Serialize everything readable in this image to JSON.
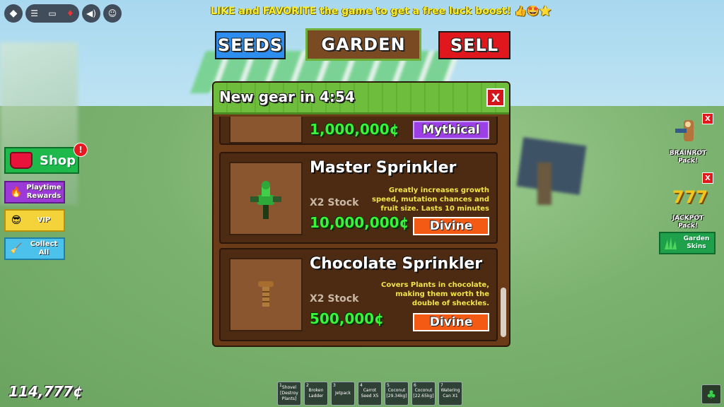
{
  "banner": {
    "text": "LIKE and FAVORITE the game to get a free luck boost! 👍🤩⭐"
  },
  "tabs": [
    {
      "label": "SEEDS"
    },
    {
      "label": "GARDEN"
    },
    {
      "label": "SELL"
    }
  ],
  "panel": {
    "title": "New gear in 4:54",
    "close_label": "X",
    "items": [
      {
        "name": "",
        "stock": "",
        "price": "1,000,000¢",
        "description": "",
        "rarity": "Mythical"
      },
      {
        "name": "Master Sprinkler",
        "stock": "X2 Stock",
        "price": "10,000,000¢",
        "description": "Greatly increases growth speed, mutation chances and fruit size. Lasts 10 minutes",
        "rarity": "Divine"
      },
      {
        "name": "Chocolate Sprinkler",
        "stock": "X2 Stock",
        "price": "500,000¢",
        "description": "Covers Plants in chocolate, making them worth the double of sheckles.",
        "rarity": "Divine"
      }
    ]
  },
  "left_menu": {
    "shop": {
      "label": "Shop",
      "badge": "!"
    },
    "playtime": {
      "label": "Playtime Rewards"
    },
    "vip": {
      "label": "VIP"
    },
    "collect": {
      "label": "Collect All"
    }
  },
  "right_menu": {
    "brainrot": {
      "label": "BRAINROT Pack!",
      "close": "X"
    },
    "jackpot": {
      "label": "JACKPOT Pack!",
      "close": "X",
      "digits": "777"
    },
    "skins": {
      "label": "Garden Skins"
    }
  },
  "money": "114,777¢",
  "hotbar": [
    {
      "num": "1",
      "label": "Shovel [Destroy Plants]"
    },
    {
      "num": "2",
      "label": "Broken Ladder"
    },
    {
      "num": "3",
      "label": "Jetpack"
    },
    {
      "num": "4",
      "label": "Carrot Seed X5"
    },
    {
      "num": "5",
      "label": "Coconut [29.34kg]"
    },
    {
      "num": "6",
      "label": "Coconut [22.65kg]"
    },
    {
      "num": "7",
      "label": "Watering Can X1"
    }
  ],
  "colors": {
    "divine": "#f45a14",
    "mythical": "#9c3fe6",
    "price": "#39f53a"
  },
  "icons": [
    "roblox-logo-icon",
    "menu-icon",
    "chat-icon",
    "mic-muted-icon",
    "volume-icon",
    "avatar-icon",
    "basket-icon",
    "fire-icon",
    "sunglasses-icon",
    "broom-icon",
    "grass-icon",
    "clover-icon",
    "sprinkler-icon"
  ]
}
